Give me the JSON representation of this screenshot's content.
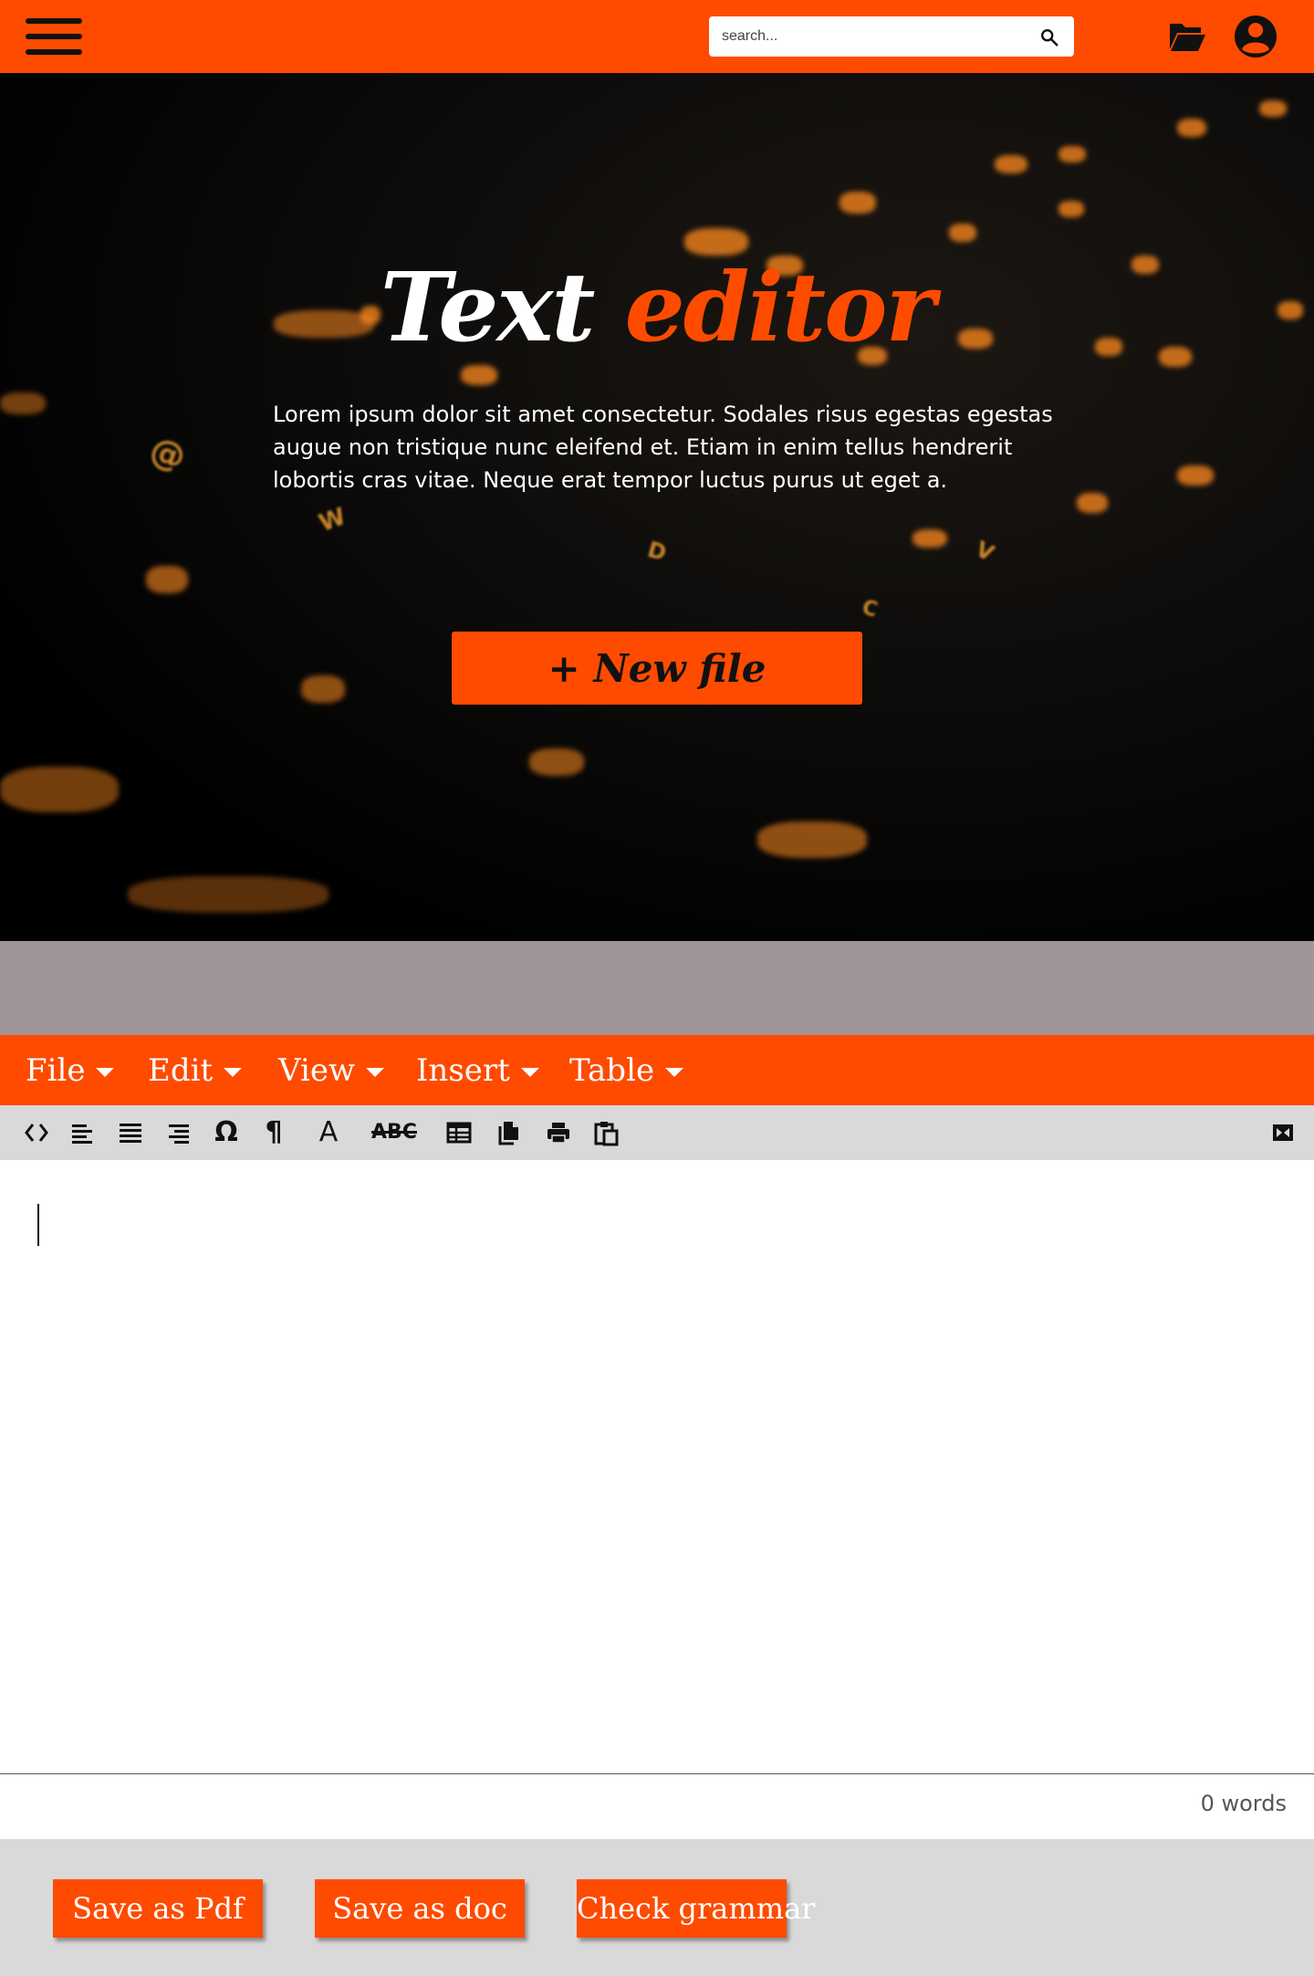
{
  "header": {
    "menu_icon": "hamburger-menu-icon",
    "search_placeholder": "search...",
    "search_icon": "search-icon",
    "folder_icon": "folder-open-icon",
    "account_icon": "account-circle-icon"
  },
  "hero": {
    "title_part1": "Text",
    "title_part2": "editor",
    "description": "Lorem ipsum dolor sit amet consectetur. Sodales risus egestas egestas augue non tristique nunc eleifend et. Etiam in enim tellus hendrerit lobortis cras vitae. Neque erat tempor luctus purus ut eget a.",
    "new_file_label": "+ New file"
  },
  "menubar": {
    "items": [
      {
        "label": "File"
      },
      {
        "label": "Edit"
      },
      {
        "label": "View"
      },
      {
        "label": "Insert"
      },
      {
        "label": "Table"
      }
    ]
  },
  "toolbar": {
    "tools": [
      "source-code-icon",
      "align-left-icon",
      "align-justify-icon",
      "align-right-icon",
      "special-character-icon",
      "pilcrow-icon",
      "font-icon",
      "strikethrough-icon",
      "table-icon",
      "copy-icon",
      "print-icon",
      "paste-icon",
      "fullscreen-icon"
    ],
    "omega_glyph": "Ω",
    "pilcrow_glyph": "¶",
    "font_glyph": "A",
    "strike_glyph": "ABC"
  },
  "editor": {
    "content": "",
    "word_count": "0 words"
  },
  "footer": {
    "save_pdf_label": "Save as Pdf",
    "save_doc_label": "Save as doc",
    "check_grammar_label": "Check grammar"
  },
  "colors": {
    "accent": "#fe4b00",
    "toolbar_bg": "#d9d9d9",
    "band": "#a09596",
    "hero_bg": "#000000"
  }
}
